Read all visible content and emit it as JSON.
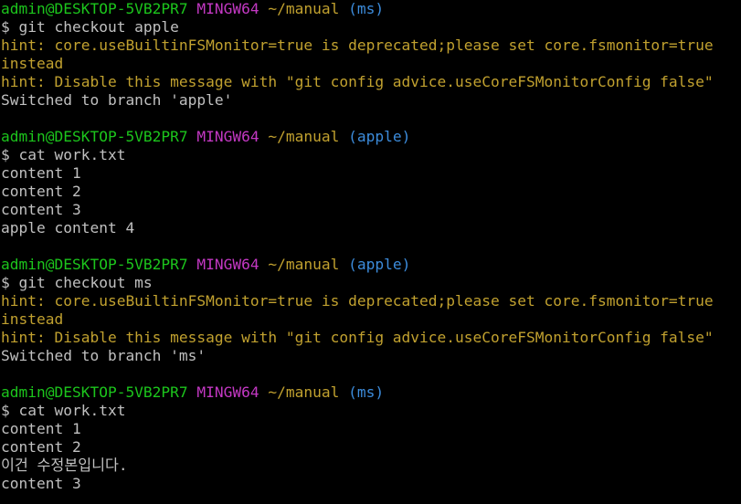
{
  "prompt": {
    "user_host": "admin@DESKTOP-5VB2PR7",
    "env": "MINGW64",
    "path": "~/manual"
  },
  "colors": {
    "background": "#000000",
    "text": "#c0c0c0",
    "user_host": "#1cc51c",
    "env": "#c338c3",
    "path": "#c1a12f",
    "branch": "#3c8cdc",
    "hint": "#c1a12f"
  },
  "blocks": [
    {
      "branch": "(ms)",
      "command": "$ git checkout apple",
      "output": [
        {
          "kind": "hint",
          "text": "hint: core.useBuiltinFSMonitor=true is deprecated;please set core.fsmonitor=true"
        },
        {
          "kind": "hint",
          "text": "instead"
        },
        {
          "kind": "hint",
          "text": "hint: Disable this message with \"git config advice.useCoreFSMonitorConfig false\""
        },
        {
          "kind": "out",
          "text": "Switched to branch 'apple'"
        }
      ]
    },
    {
      "branch": "(apple)",
      "command": "$ cat work.txt",
      "output": [
        {
          "kind": "out",
          "text": "content 1"
        },
        {
          "kind": "out",
          "text": "content 2"
        },
        {
          "kind": "out",
          "text": "content 3"
        },
        {
          "kind": "out",
          "text": "apple content 4"
        }
      ]
    },
    {
      "branch": "(apple)",
      "command": "$ git checkout ms",
      "output": [
        {
          "kind": "hint",
          "text": "hint: core.useBuiltinFSMonitor=true is deprecated;please set core.fsmonitor=true"
        },
        {
          "kind": "hint",
          "text": "instead"
        },
        {
          "kind": "hint",
          "text": "hint: Disable this message with \"git config advice.useCoreFSMonitorConfig false\""
        },
        {
          "kind": "out",
          "text": "Switched to branch 'ms'"
        }
      ]
    },
    {
      "branch": "(ms)",
      "command": "$ cat work.txt",
      "output": [
        {
          "kind": "out",
          "text": "content 1"
        },
        {
          "kind": "out",
          "text": "content 2"
        },
        {
          "kind": "out",
          "text": "이건 수정본입니다."
        },
        {
          "kind": "out",
          "text": "content 3"
        }
      ]
    }
  ]
}
